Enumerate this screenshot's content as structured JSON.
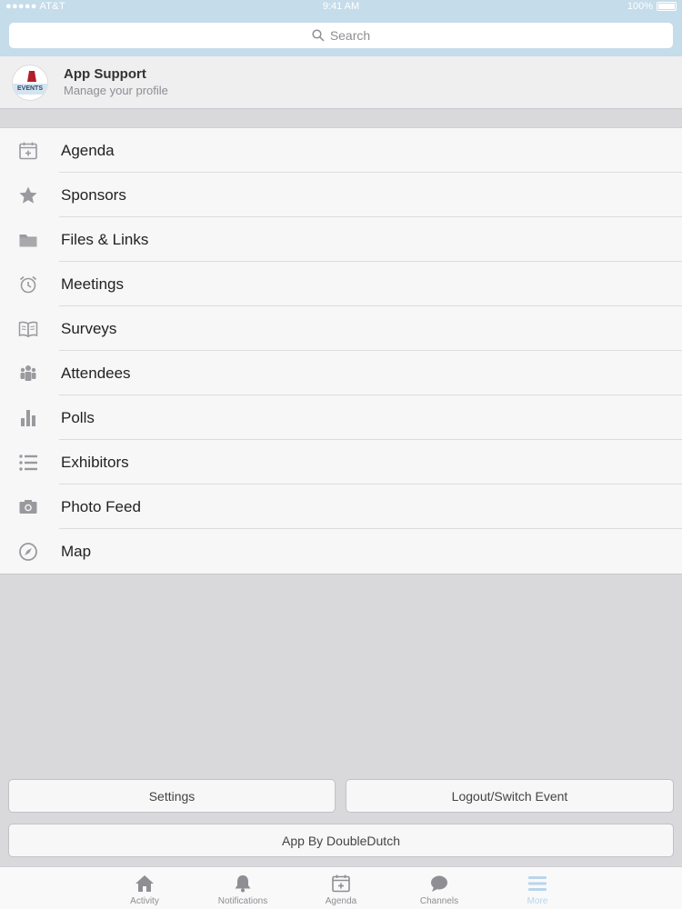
{
  "status_bar": {
    "carrier": "●●●●● AT&T",
    "time": "9:41 AM",
    "battery": "100%"
  },
  "search": {
    "placeholder": "Search"
  },
  "profile": {
    "avatar_label": "EVENTS",
    "name": "App Support",
    "subtitle": "Manage your profile"
  },
  "menu": {
    "items": [
      {
        "label": "Agenda",
        "icon": "calendar-icon"
      },
      {
        "label": "Sponsors",
        "icon": "star-icon"
      },
      {
        "label": "Files & Links",
        "icon": "folder-icon"
      },
      {
        "label": "Meetings",
        "icon": "alarm-clock-icon"
      },
      {
        "label": "Surveys",
        "icon": "book-icon"
      },
      {
        "label": "Attendees",
        "icon": "people-icon"
      },
      {
        "label": "Polls",
        "icon": "bar-chart-icon"
      },
      {
        "label": "Exhibitors",
        "icon": "list-icon"
      },
      {
        "label": "Photo Feed",
        "icon": "camera-icon"
      },
      {
        "label": "Map",
        "icon": "compass-icon"
      }
    ]
  },
  "buttons": {
    "settings": "Settings",
    "logout": "Logout/Switch Event",
    "app_by": "App By DoubleDutch"
  },
  "tabs": [
    {
      "label": "Activity",
      "icon": "home-icon"
    },
    {
      "label": "Notifications",
      "icon": "bell-icon"
    },
    {
      "label": "Agenda",
      "icon": "calendar-icon"
    },
    {
      "label": "Channels",
      "icon": "chat-bubble-icon"
    },
    {
      "label": "More",
      "icon": "menu-lines-icon",
      "active": true
    }
  ],
  "colors": {
    "icon_gray": "#9a9a9e",
    "tab_active": "#b9d5ea",
    "header_bg": "#c5dcea"
  }
}
